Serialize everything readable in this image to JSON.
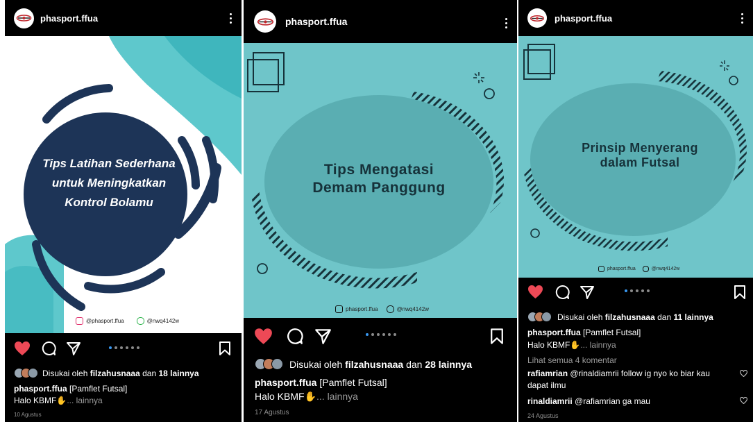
{
  "colors": {
    "teal": "#5ec8cc",
    "navy": "#1d3457",
    "like_red": "#ed4956",
    "link_blue": "#3897f0",
    "gray": "#8e8e8e"
  },
  "posts": [
    {
      "username": "phasport.ffua",
      "image_title_lines": [
        "Tips Latihan Sederhana",
        "untuk Meningkatkan",
        "Kontrol Bolamu"
      ],
      "credit_instagram": "@phasport.ffua",
      "credit_line": "@nwq4142w",
      "carousel_count": 6,
      "carousel_active": 0,
      "likes_prefix": "Disukai oleh",
      "likes_user": "filzahusnaaa",
      "likes_connector": "dan",
      "likes_rest": "18 lainnya",
      "caption_user": "phasport.ffua",
      "caption_text": "[Pamflet Futsal]",
      "caption_line2": "Halo KBMF",
      "caption_more": "... lainnya",
      "date": "10 Agustus"
    },
    {
      "username": "phasport.ffua",
      "image_title_lines": [
        "Tips Mengatasi",
        "Demam Panggung"
      ],
      "credit_instagram": "phasport.ffua",
      "credit_line": "@nwq4142w",
      "carousel_count": 6,
      "carousel_active": 0,
      "likes_prefix": "Disukai oleh",
      "likes_user": "filzahusnaaa",
      "likes_connector": "dan",
      "likes_rest": "28 lainnya",
      "caption_user": "phasport.ffua",
      "caption_text": "[Pamflet Futsal]",
      "caption_line2": "Halo KBMF",
      "caption_more": "... lainnya",
      "date": "17 Agustus"
    },
    {
      "username": "phasport.ffua",
      "image_title_lines": [
        "Prinsip Menyerang",
        "dalam Futsal"
      ],
      "credit_instagram": "phasport.ffua",
      "credit_line": "@nwq4142w",
      "carousel_count": 5,
      "carousel_active": 0,
      "likes_prefix": "Disukai oleh",
      "likes_user": "filzahusnaaa",
      "likes_connector": "dan",
      "likes_rest": "11 lainnya",
      "caption_user": "phasport.ffua",
      "caption_text": "[Pamflet Futsal]",
      "caption_line2": "Halo KBMF",
      "caption_more": "... lainnya",
      "view_comments": "Lihat semua 4 komentar",
      "comments": [
        {
          "user": "rafiamrian",
          "text_line1": "@rinaldiamrii follow ig nyo ko biar kau",
          "text_line2": "dapat ilmu"
        },
        {
          "user": "rinaldiamrii",
          "text_line1": "@rafiamrian ga mau"
        }
      ],
      "date": "24 Agustus"
    }
  ]
}
